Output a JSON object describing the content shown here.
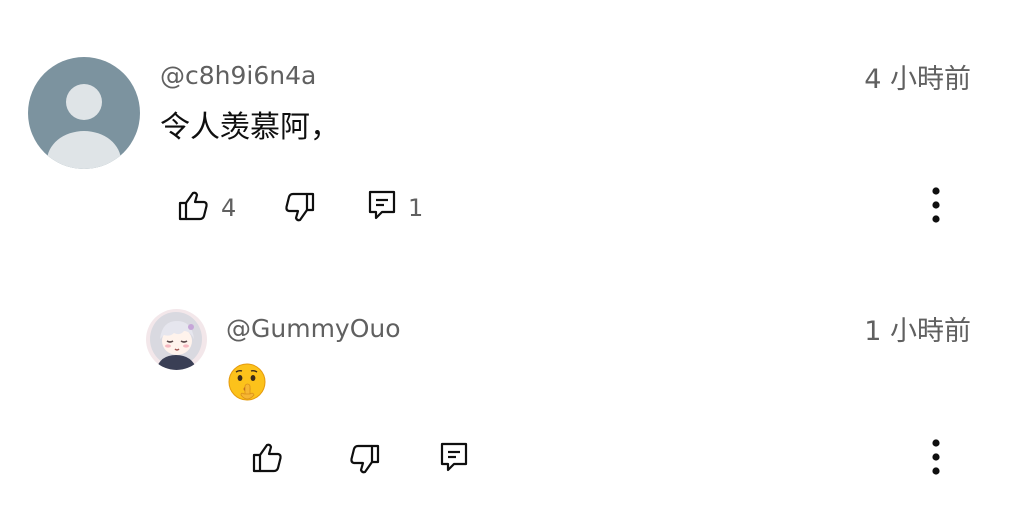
{
  "comments": [
    {
      "handle": "@c8h9i6n4a",
      "time": "4 小時前",
      "text": "令人羡慕阿，",
      "like_count": "4",
      "reply_count": "1",
      "avatar_icon": "default-user-avatar"
    },
    {
      "handle": "@GummyOuo",
      "time": "1 小時前",
      "text": "🤫",
      "avatar_icon": "anime-girl-avatar"
    }
  ],
  "icons": {
    "like": "thumbs-up-icon",
    "dislike": "thumbs-down-icon",
    "reply": "reply-icon",
    "more": "more-vertical-icon"
  },
  "colors": {
    "secondary_text": "#606060",
    "primary_text": "#0f0f0f",
    "default_avatar_bg": "#7c939f",
    "default_avatar_fg": "#dfe4e7"
  }
}
